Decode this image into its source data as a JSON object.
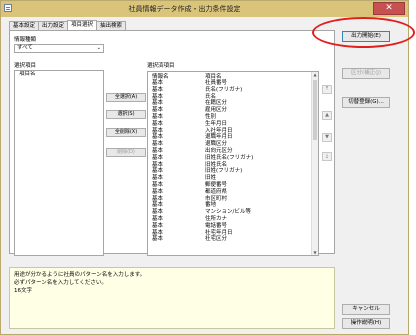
{
  "window": {
    "title": "社員情報データ作成・出力条件設定",
    "close_glyph": "✕"
  },
  "tabs": [
    {
      "label": "基本設定",
      "active": false
    },
    {
      "label": "出力設定",
      "active": false
    },
    {
      "label": "項目選択",
      "active": true
    },
    {
      "label": "抽出検索",
      "active": false
    }
  ],
  "info_type": {
    "label": "情報種類",
    "value": "すべて",
    "chevron": "⌄"
  },
  "available_items": {
    "label": "選択項目",
    "header": "項目名"
  },
  "mid_buttons": {
    "select_all": "全選択(A)",
    "select": "選択(S)",
    "deselect_all": "全削除(X)",
    "delete": "削除(D)"
  },
  "selected_items": {
    "label": "選択済項目",
    "headers": [
      "情報名",
      "項目名"
    ],
    "rows": [
      [
        "基本",
        "社員番号"
      ],
      [
        "基本",
        "氏名(フリガナ)"
      ],
      [
        "基本",
        "氏名"
      ],
      [
        "基本",
        "在籍区分"
      ],
      [
        "基本",
        "雇用区分"
      ],
      [
        "基本",
        "性別"
      ],
      [
        "基本",
        "生年月日"
      ],
      [
        "基本",
        "入社年月日"
      ],
      [
        "基本",
        "退職年月日"
      ],
      [
        "基本",
        "退職区分"
      ],
      [
        "基本",
        "出向元区分"
      ],
      [
        "基本",
        "旧姓氏名(フリガナ)"
      ],
      [
        "基本",
        "旧姓氏名"
      ],
      [
        "基本",
        "旧姓(フリガナ)"
      ],
      [
        "基本",
        "旧姓"
      ],
      [
        "基本",
        "郵便番号"
      ],
      [
        "基本",
        "都道府県"
      ],
      [
        "基本",
        "市区町村"
      ],
      [
        "基本",
        "番地"
      ],
      [
        "基本",
        "マンション/ビル等"
      ],
      [
        "基本",
        "住所カナ"
      ],
      [
        "基本",
        "電話番号"
      ],
      [
        "基本",
        "社宅年月日"
      ],
      [
        "基本",
        "社宅区分"
      ]
    ]
  },
  "order_buttons": [
    "⤒",
    "▲",
    "▼",
    "⤓"
  ],
  "help_text": [
    "用途が分かるように社員のパターン名を入力します。",
    "必ずパターン名を入力してください。",
    "16文字"
  ],
  "right_buttons": {
    "output_start": "出力開始(E)",
    "read_condition": "区分(補正(J)",
    "save_condition": "切替登録(G)...",
    "cancel": "キャンセル",
    "help": "操作説明(H)"
  }
}
